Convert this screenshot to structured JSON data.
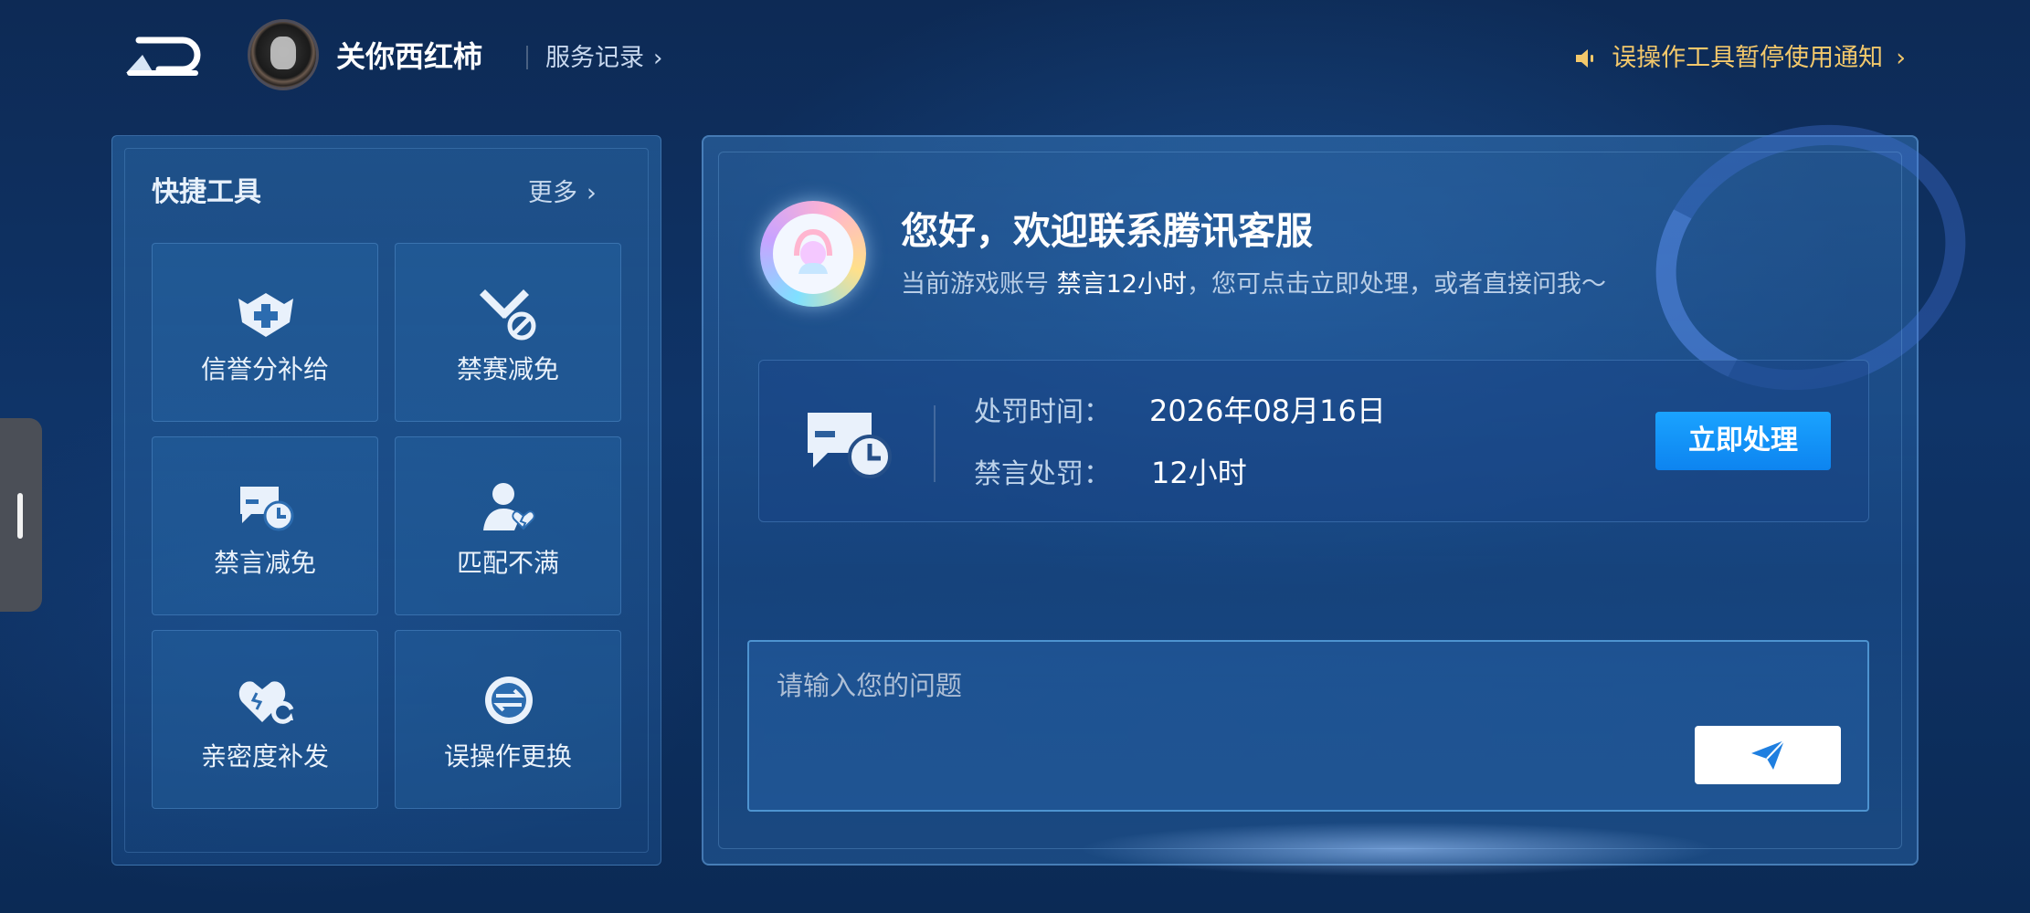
{
  "header": {
    "username": "关你西红柿",
    "service_record": "服务记录",
    "notice": "误操作工具暂停使用通知"
  },
  "quick_tools": {
    "title": "快捷工具",
    "more": "更多",
    "items": [
      {
        "label": "信誉分补给",
        "icon": "shield-plus-icon"
      },
      {
        "label": "禁赛减免",
        "icon": "sword-ban-icon"
      },
      {
        "label": "禁言减免",
        "icon": "chat-clock-icon"
      },
      {
        "label": "匹配不满",
        "icon": "user-heartbreak-icon"
      },
      {
        "label": "亲密度补发",
        "icon": "heart-refresh-icon"
      },
      {
        "label": "误操作更换",
        "icon": "swap-circle-icon"
      }
    ]
  },
  "chat": {
    "greeting": "您好，欢迎联系腾讯客服",
    "sub_prefix": "当前游戏账号 ",
    "sub_highlight": "禁言12小时",
    "sub_suffix": "，您可点击立即处理，或者直接问我～"
  },
  "penalty": {
    "time_label": "处罚时间：",
    "time_value": "2026年08月16日",
    "type_label": "禁言处罚：",
    "type_value": "12小时",
    "action_label": "立即处理"
  },
  "input": {
    "placeholder": "请输入您的问题",
    "value": ""
  },
  "colors": {
    "accent": "#1aa3ff",
    "notice": "#f3c86b",
    "background": "#0f3468"
  }
}
